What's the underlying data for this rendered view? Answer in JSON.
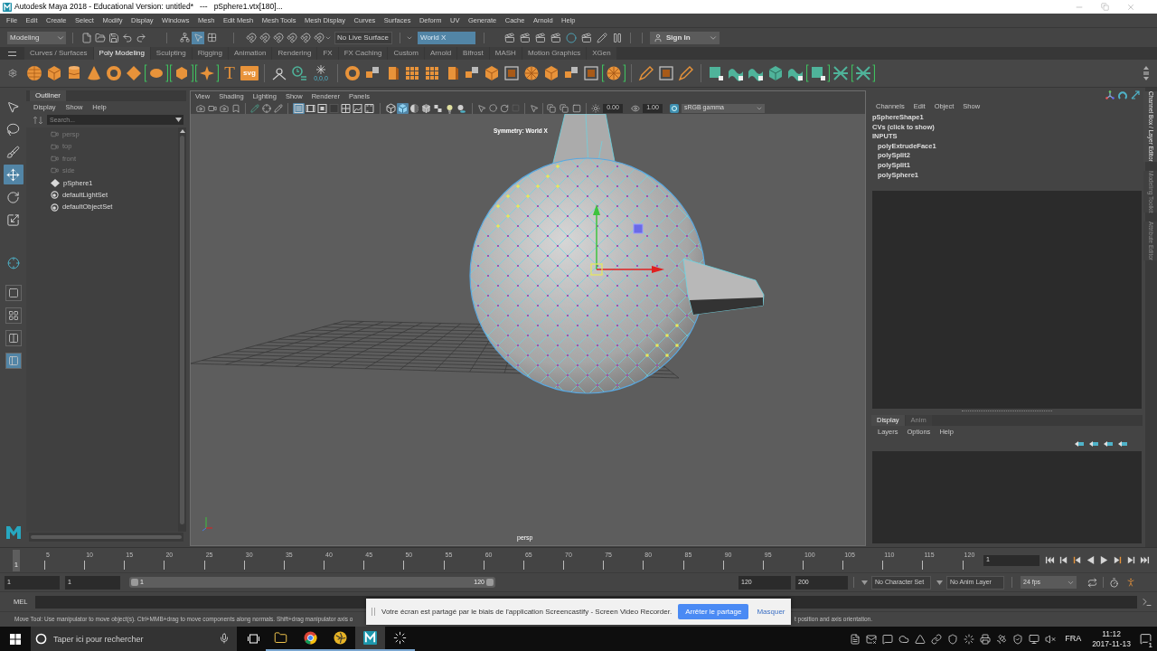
{
  "window": {
    "title": "Autodesk Maya 2018 - Educational Version: untitled*   ---   pSphere1.vtx[180]..."
  },
  "menu_bar": [
    "File",
    "Edit",
    "Create",
    "Select",
    "Modify",
    "Display",
    "Windows",
    "Mesh",
    "Edit Mesh",
    "Mesh Tools",
    "Mesh Display",
    "Curves",
    "Surfaces",
    "Deform",
    "UV",
    "Generate",
    "Cache",
    "Arnold",
    "Help"
  ],
  "status_line": {
    "menu_set": "Modeling",
    "selection_modes": [
      {
        "kind": "hierarchy",
        "selected": false
      },
      {
        "kind": "object",
        "selected": true
      },
      {
        "kind": "component",
        "selected": false
      }
    ],
    "live_surface": "No Live Surface",
    "symmetry": "World X",
    "sign_in": "Sign In"
  },
  "shelf_tabs": [
    {
      "label": "Curves / Surfaces",
      "selected": false
    },
    {
      "label": "Poly Modeling",
      "selected": true
    },
    {
      "label": "Sculpting",
      "selected": false
    },
    {
      "label": "Rigging",
      "selected": false
    },
    {
      "label": "Animation",
      "selected": false
    },
    {
      "label": "Rendering",
      "selected": false
    },
    {
      "label": "FX",
      "selected": false
    },
    {
      "label": "FX Caching",
      "selected": false
    },
    {
      "label": "Custom",
      "selected": false
    },
    {
      "label": "Arnold",
      "selected": false
    },
    {
      "label": "Bifrost",
      "selected": false
    },
    {
      "label": "MASH",
      "selected": false
    },
    {
      "label": "Motion Graphics",
      "selected": false
    },
    {
      "label": "XGen",
      "selected": false
    }
  ],
  "shelf": {
    "type_tool": "T",
    "svg_tool": "svg",
    "pivot_reading": "0,0,0"
  },
  "toolbox": {
    "tools": [
      {
        "kind": "select",
        "selected": false
      },
      {
        "kind": "lasso",
        "selected": false
      },
      {
        "kind": "paint",
        "selected": false
      },
      {
        "kind": "move",
        "selected": true
      },
      {
        "kind": "rotate",
        "selected": false
      },
      {
        "kind": "scale",
        "selected": false
      }
    ],
    "layouts": [
      {
        "kind": "single",
        "selected": false
      },
      {
        "kind": "quad",
        "selected": false
      },
      {
        "kind": "split",
        "selected": false
      },
      {
        "kind": "outliner",
        "selected": true
      }
    ]
  },
  "outliner": {
    "title": "Outliner",
    "menus": [
      "Display",
      "Show",
      "Help"
    ],
    "search": {
      "placeholder": "Search..."
    },
    "items": [
      {
        "label": "persp",
        "kind": "camera",
        "hidden": true
      },
      {
        "label": "top",
        "kind": "camera",
        "hidden": true
      },
      {
        "label": "front",
        "kind": "camera",
        "hidden": true
      },
      {
        "label": "side",
        "kind": "camera",
        "hidden": true
      },
      {
        "label": "pSphere1",
        "kind": "transform",
        "hidden": false
      },
      {
        "label": "defaultLightSet",
        "kind": "set",
        "hidden": false
      },
      {
        "label": "defaultObjectSet",
        "kind": "set",
        "hidden": false
      }
    ]
  },
  "viewport": {
    "menus": [
      "View",
      "Shading",
      "Lighting",
      "Show",
      "Renderer",
      "Panels"
    ],
    "view_toggles": [
      {
        "kind": "list",
        "on": true
      },
      {
        "kind": "film",
        "on": false
      },
      {
        "kind": "gate",
        "on": false
      },
      {
        "kind": "mask",
        "on": false
      },
      {
        "kind": "grid",
        "on": false
      },
      {
        "kind": "image",
        "on": false
      },
      {
        "kind": "hud",
        "on": false
      }
    ],
    "shading_toggles": [
      {
        "kind": "wireframe",
        "on": false
      },
      {
        "kind": "shaded",
        "on": true
      },
      {
        "kind": "halfshade",
        "on": false
      },
      {
        "kind": "wire-on-shaded",
        "on": false
      },
      {
        "kind": "checker",
        "on": false
      },
      {
        "kind": "light",
        "on": false
      },
      {
        "kind": "shadow",
        "on": false
      }
    ],
    "exposure": "0.00",
    "gamma": "1.00",
    "color_space": "sRGB gamma",
    "symmetry_label": "Symmetry: World X",
    "camera_label": "persp"
  },
  "channel_box": {
    "menus": [
      "Channels",
      "Edit",
      "Object",
      "Show"
    ],
    "nodes": [
      {
        "label": "pSphereShape1"
      },
      {
        "label": "CVs (click to show)"
      },
      {
        "label": "INPUTS",
        "children": [
          {
            "label": "polyExtrudeFace1"
          },
          {
            "label": "polySplit2"
          },
          {
            "label": "polySplit1"
          },
          {
            "label": "polySphere1"
          }
        ]
      }
    ]
  },
  "layer_editor": {
    "tabs": [
      {
        "label": "Display",
        "selected": true
      },
      {
        "label": "Anim",
        "selected": false
      }
    ],
    "menus": [
      "Layers",
      "Options",
      "Help"
    ]
  },
  "side_tabs": [
    {
      "label": "Channel Box / Layer Editor",
      "selected": true
    },
    {
      "label": "Modeling Toolkit",
      "selected": false
    },
    {
      "label": "Attribute Editor",
      "selected": false
    }
  ],
  "time_slider": {
    "current_marker": "1",
    "ticks": [
      "5",
      "10",
      "15",
      "20",
      "25",
      "30",
      "35",
      "40",
      "45",
      "50",
      "55",
      "60",
      "65",
      "70",
      "75",
      "80",
      "85",
      "90",
      "95",
      "100",
      "105",
      "110",
      "115",
      "120"
    ],
    "current_frame": "1"
  },
  "range_slider": {
    "start": "1",
    "playback_start": "1",
    "range_start": "1",
    "range_end": "120",
    "playback_end": "120",
    "end": "200",
    "character_set": "No Character Set",
    "anim_layer": "No Anim Layer",
    "fps": "24 fps"
  },
  "command_line": {
    "language": "MEL"
  },
  "help_line": [
    "Move Tool: Use manipulator to move object(s). Ctrl+MMB+drag to move components along normals. Shift+drag manipulator axis o",
    "t position and axis orientation."
  ],
  "share_notification": {
    "message": "Votre écran est partagé par le biais de l'application Screencastify - Screen Video Recorder.",
    "stop_button": "Arrêter le partage",
    "hide_link": "Masquer"
  },
  "taskbar": {
    "search_placeholder": "Taper ici pour rechercher",
    "apps": [
      {
        "kind": "files",
        "running": true,
        "selected": false
      },
      {
        "kind": "browser",
        "running": true,
        "selected": false
      },
      {
        "kind": "aperture",
        "running": true,
        "selected": false
      },
      {
        "kind": "maya",
        "running": true,
        "selected": true
      },
      {
        "kind": "loader",
        "running": true,
        "selected": false
      }
    ],
    "language": "FRA",
    "time": "11:12",
    "date": "2017-11-13",
    "notifications": "1"
  }
}
